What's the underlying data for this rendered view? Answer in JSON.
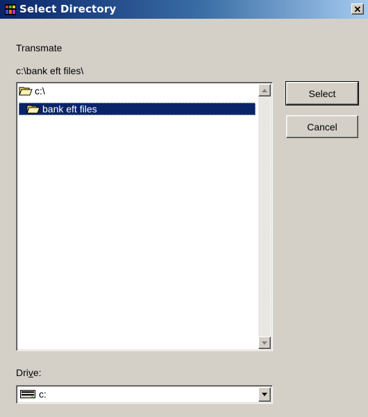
{
  "window": {
    "title": "Select Directory",
    "close_label": "✕"
  },
  "app_name": "Transmate",
  "current_path": "c:\\bank eft files\\",
  "folders": [
    {
      "label": "c:\\",
      "icon": "open-folder-icon",
      "selected": false
    },
    {
      "label": "bank eft files",
      "icon": "open-folder-icon",
      "selected": true
    }
  ],
  "buttons": {
    "select": "Select",
    "cancel": "Cancel"
  },
  "drive": {
    "label_pre": "Dri",
    "label_accel": "v",
    "label_post": "e:",
    "value": "c:"
  },
  "colors": {
    "title_start": "#0a246a",
    "title_end": "#a6caf0",
    "face": "#d4d0c8",
    "selection": "#0a246a",
    "folder": "#f6d66e"
  }
}
